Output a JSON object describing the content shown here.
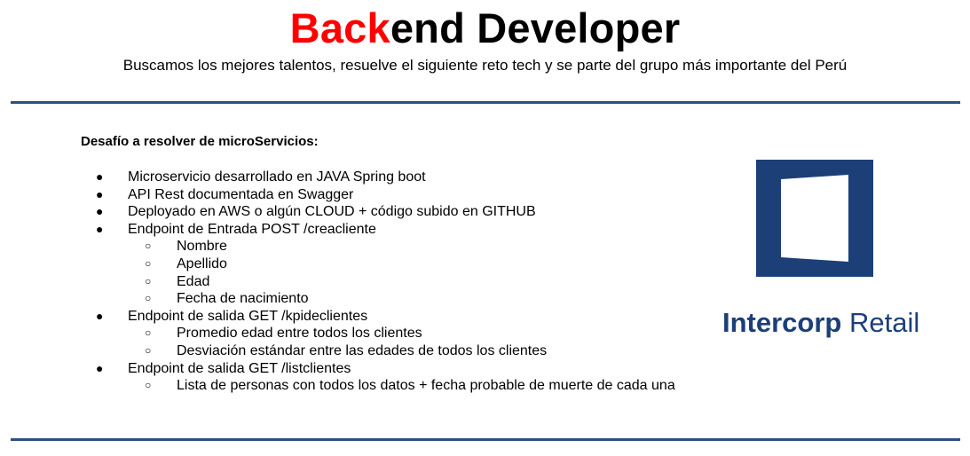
{
  "header": {
    "title_accent": "Back",
    "title_rest": "end Developer",
    "subtitle": "Buscamos los mejores talentos, resuelve el siguiente reto tech y se parte del grupo más importante del Perú"
  },
  "challenge": {
    "heading": "Desafío a resolver de microServicios:",
    "items": [
      {
        "level": 1,
        "text": "Microservicio desarrollado en JAVA Spring boot"
      },
      {
        "level": 1,
        "text": "API Rest documentada en Swagger"
      },
      {
        "level": 1,
        "text": "Deployado en AWS o algún CLOUD + código subido en GITHUB"
      },
      {
        "level": 1,
        "text": "Endpoint de Entrada POST /creacliente"
      },
      {
        "level": 2,
        "text": "Nombre"
      },
      {
        "level": 2,
        "text": "Apellido"
      },
      {
        "level": 2,
        "text": "Edad"
      },
      {
        "level": 2,
        "text": "Fecha de nacimiento"
      },
      {
        "level": 1,
        "text": "Endpoint de salida GET  /kpideclientes"
      },
      {
        "level": 2,
        "text": "Promedio edad entre todos los clientes"
      },
      {
        "level": 2,
        "text": "Desviación estándar entre las edades de todos los clientes"
      },
      {
        "level": 1,
        "text": "Endpoint de salida GET /listclientes"
      },
      {
        "level": 2,
        "text": "Lista de personas con todos los datos + fecha probable de muerte de cada una"
      }
    ]
  },
  "logo": {
    "word1": "Intercorp",
    "word2": " Retail",
    "color": "#1c3f78"
  },
  "colors": {
    "accent": "#ff0000",
    "rule": "#2f4f7f"
  }
}
